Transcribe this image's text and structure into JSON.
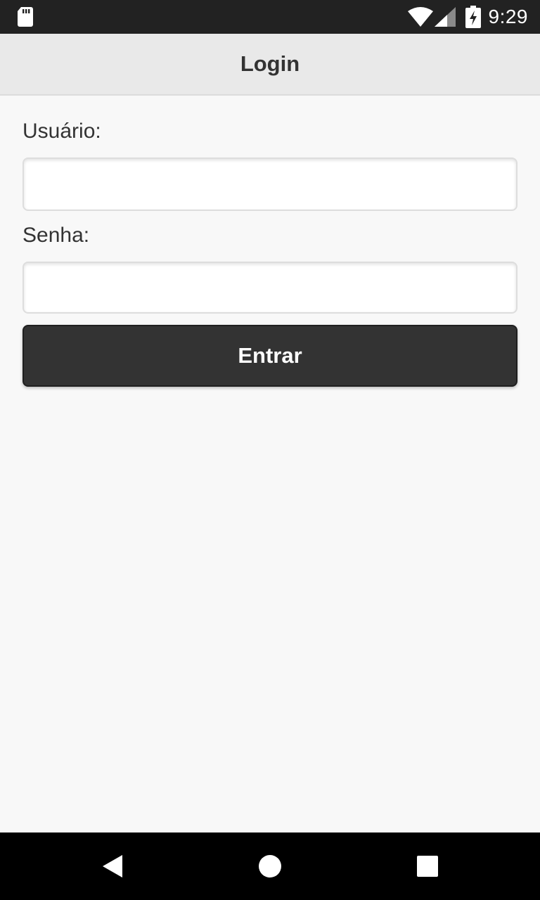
{
  "status_bar": {
    "time": "9:29",
    "icons": [
      "sd-card-icon",
      "wifi-icon",
      "cell-signal-icon",
      "battery-charging-icon"
    ]
  },
  "header": {
    "title": "Login"
  },
  "form": {
    "username_label": "Usuário:",
    "username_value": "",
    "username_placeholder": "",
    "password_label": "Senha:",
    "password_value": "",
    "password_placeholder": "",
    "submit_label": "Entrar"
  },
  "nav_bar": {
    "icons": [
      "back-icon",
      "home-icon",
      "recents-icon"
    ]
  },
  "colors": {
    "status_bar": "#222222",
    "header_bg": "#e9e9e9",
    "page_bg": "#f8f8f8",
    "button_bg": "#333333",
    "nav_bar": "#000000"
  }
}
